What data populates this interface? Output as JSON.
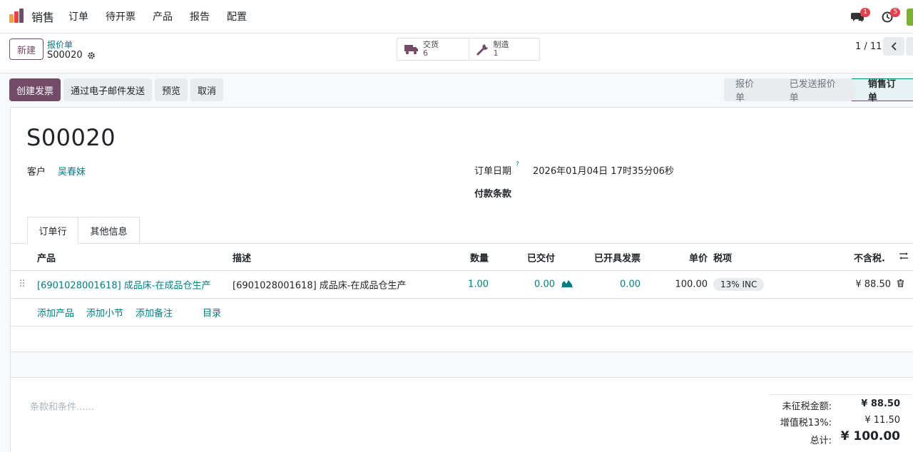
{
  "app": {
    "name": "销售"
  },
  "menu": [
    "订单",
    "待开票",
    "产品",
    "报告",
    "配置"
  ],
  "notifications": {
    "messages": "1",
    "activities": "5"
  },
  "control": {
    "new_label": "新建",
    "breadcrumb_parent": "报价单",
    "breadcrumb_current": "S00020",
    "smart_buttons": [
      {
        "label": "交货",
        "value": "6",
        "icon": "truck-icon"
      },
      {
        "label": "制造",
        "value": "1",
        "icon": "wrench-icon"
      }
    ],
    "pager": "1 / 11"
  },
  "actions": [
    "创建发票",
    "通过电子邮件发送",
    "预览",
    "取消"
  ],
  "status_stages": [
    "报价单",
    "已发送报价单",
    "销售订单"
  ],
  "active_stage": "销售订单",
  "record": {
    "name": "S00020",
    "customer_label": "客户",
    "customer_value": "吴春妹",
    "order_date_label": "订单日期",
    "order_date_help": "?",
    "order_date_value": "2026年01月04日 17时35分06秒",
    "payment_terms_label": "付款条款"
  },
  "tabs": [
    "订单行",
    "其他信息"
  ],
  "columns": {
    "product": "产品",
    "description": "描述",
    "quantity": "数量",
    "delivered": "已交付",
    "invoiced": "已开具发票",
    "unit_price": "单价",
    "taxes": "税项",
    "subtotal": "不含税."
  },
  "lines": [
    {
      "product": "[6901028001618] 成品床-在成品仓生产",
      "description": "[6901028001618] 成品床-在成品仓生产",
      "quantity": "1.00",
      "delivered": "0.00",
      "invoiced": "0.00",
      "unit_price": "100.00",
      "tax": "13% INC",
      "subtotal": "¥ 88.50"
    }
  ],
  "add_links": [
    "添加产品",
    "添加小节",
    "添加备注",
    "目录"
  ],
  "terms_placeholder": "条款和条件......",
  "totals": {
    "untaxed_label": "未征税金额:",
    "untaxed_value": "¥ 88.50",
    "vat_label": "增值税13%:",
    "vat_value": "¥ 11.50",
    "total_label": "总计:",
    "total_value": "¥ 100.00"
  },
  "colors": {
    "brand": "#714b67",
    "link": "#017e84",
    "badge": "#e4404f"
  }
}
